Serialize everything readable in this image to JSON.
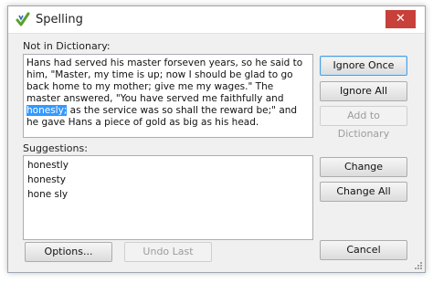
{
  "window": {
    "title": "Spelling",
    "close_glyph": "✕"
  },
  "not_in_dictionary": {
    "label": "Not in Dictionary:",
    "text_before": "Hans had served his master forseven years, so he said to him, \"Master, my time is up; now I should be glad to go back home to my mother; give me my wages.\" The master answered, \"You have served me faithfully and ",
    "highlighted_word": "honesly;",
    "text_after": " as the service was so shall the reward be;\" and he gave Hans a piece of gold as big as his head."
  },
  "suggestions": {
    "label": "Suggestions:",
    "items": [
      "honestly",
      "honesty",
      "hone sly"
    ]
  },
  "buttons": {
    "ignore_once": "Ignore Once",
    "ignore_all": "Ignore All",
    "add_to_dictionary": "Add to Dictionary",
    "change": "Change",
    "change_all": "Change All",
    "options": "Options...",
    "undo_last": "Undo Last",
    "cancel": "Cancel"
  },
  "colors": {
    "highlight": "#3399ff",
    "close": "#c7403a"
  },
  "icons": {
    "app": "spelling-check-icon",
    "close": "close-icon",
    "resize": "resize-grip-icon"
  }
}
